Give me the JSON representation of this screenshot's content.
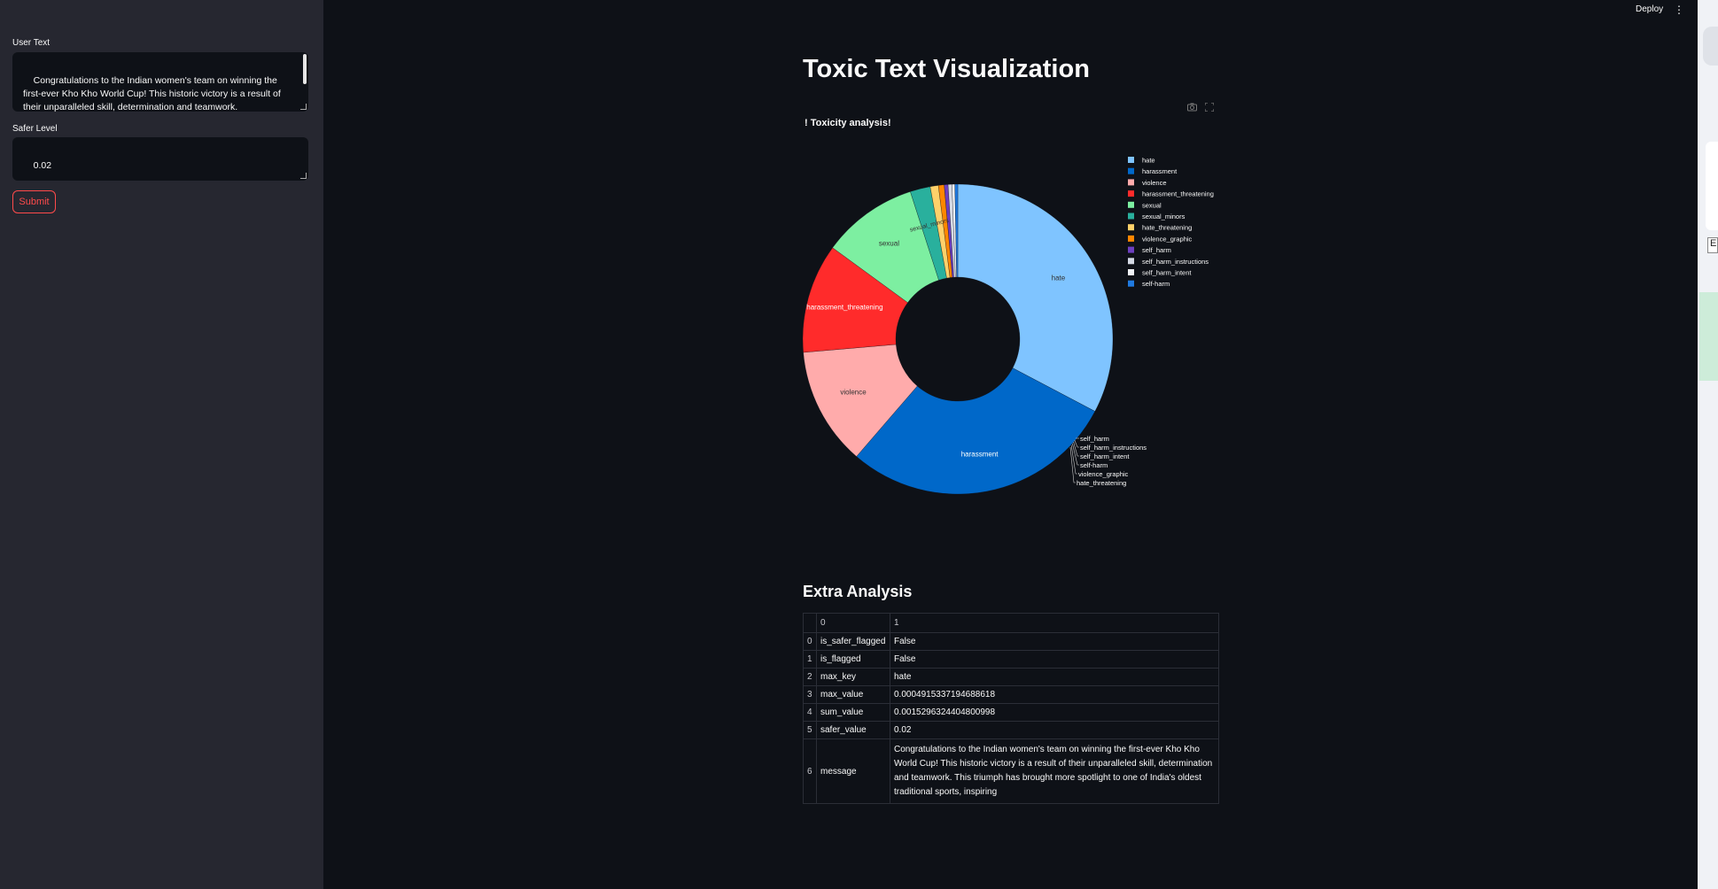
{
  "header": {
    "deploy_label": "Deploy",
    "more_icon": "kebab-menu-icon"
  },
  "sidebar": {
    "user_text_label": "User Text",
    "user_text_value": "Congratulations to the Indian women's team on winning the first-ever Kho Kho World Cup! This historic victory is a result of their unparalleled skill, determination and teamwork.",
    "safer_level_label": "Safer Level",
    "safer_level_value": "0.02",
    "submit_label": "Submit"
  },
  "main": {
    "title": "Toxic Text Visualization",
    "extra_analysis_title": "Extra Analysis"
  },
  "chart_data": {
    "type": "pie",
    "hole": true,
    "title": "! Toxicity analysis!",
    "legend_position": "right",
    "slices": [
      {
        "label": "hate",
        "share": 0.327,
        "color": "#7fc4ff",
        "text_color": "#333333",
        "label_inside": true
      },
      {
        "label": "harassment",
        "share": 0.286,
        "color": "#0068c9",
        "text_color": "#ffffff",
        "label_inside": true
      },
      {
        "label": "violence",
        "share": 0.123,
        "color": "#ffabab",
        "text_color": "#333333",
        "label_inside": true
      },
      {
        "label": "harassment_threatening",
        "share": 0.114,
        "color": "#ff2b2b",
        "text_color": "#ffffff",
        "label_inside": true
      },
      {
        "label": "sexual",
        "share": 0.1,
        "color": "#7defa1",
        "text_color": "#333333",
        "label_inside": true
      },
      {
        "label": "sexual_minors",
        "share": 0.021,
        "color": "#29b09d",
        "text_color": "#333333",
        "label_inside": true
      },
      {
        "label": "hate_threatening",
        "share": 0.0085,
        "color": "#ffd16a",
        "text_color": "#333333",
        "label_inside": false
      },
      {
        "label": "violence_graphic",
        "share": 0.006,
        "color": "#ff8700",
        "text_color": "#333333",
        "label_inside": false
      },
      {
        "label": "self_harm",
        "share": 0.004,
        "color": "#6d3fc0",
        "text_color": "#333333",
        "label_inside": false
      },
      {
        "label": "self_harm_instructions",
        "share": 0.004,
        "color": "#d5dae5",
        "text_color": "#333333",
        "label_inside": false
      },
      {
        "label": "self_harm_intent",
        "share": 0.003,
        "color": "#f0f2f6",
        "text_color": "#333333",
        "label_inside": false
      },
      {
        "label": "self-harm",
        "share": 0.003,
        "color": "#1f7ae0",
        "text_color": "#333333",
        "label_inside": false
      }
    ],
    "outside_labels": [
      "self_harm",
      "self_harm_instructions",
      "self_harm_intent",
      "self-harm",
      "violence_graphic",
      "hate_threatening"
    ],
    "legend": [
      "hate",
      "harassment",
      "violence",
      "harassment_threatening",
      "sexual",
      "sexual_minors",
      "hate_threatening",
      "violence_graphic",
      "self_harm",
      "self_harm_instructions",
      "self_harm_intent",
      "self-harm"
    ]
  },
  "table": {
    "columns": [
      "0",
      "1"
    ],
    "rows": [
      {
        "index": "0",
        "key": "is_safer_flagged",
        "value": "False"
      },
      {
        "index": "1",
        "key": "is_flagged",
        "value": "False"
      },
      {
        "index": "2",
        "key": "max_key",
        "value": "hate"
      },
      {
        "index": "3",
        "key": "max_value",
        "value": "0.0004915337194688618"
      },
      {
        "index": "4",
        "key": "sum_value",
        "value": "0.0015296324404800998"
      },
      {
        "index": "5",
        "key": "safer_value",
        "value": "0.02"
      },
      {
        "index": "6",
        "key": "message",
        "value": "Congratulations to the Indian women's team on winning the first-ever Kho Kho World Cup! This historic victory is a result of their unparalleled skill, determination and teamwork. This triumph has brought more spotlight to one of India's oldest traditional sports, inspiring"
      }
    ]
  },
  "edge": {
    "e_label": "E"
  }
}
